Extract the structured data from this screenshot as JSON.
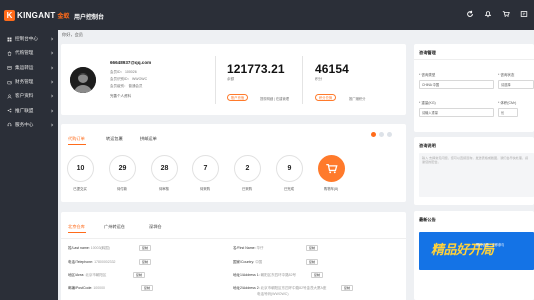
{
  "header": {
    "logo_mark": "K",
    "logo_text": "KINGANT",
    "logo_sub": "金蚁",
    "site_title": "用户控制台",
    "icons": [
      "refresh-icon",
      "bell-icon",
      "cart-icon",
      "coupon-icon"
    ]
  },
  "sidebar": {
    "items": [
      {
        "label": "控制台中心",
        "icon": "dashboard-icon"
      },
      {
        "label": "代购管理",
        "icon": "shopping-icon"
      },
      {
        "label": "集运转运",
        "icon": "package-icon"
      },
      {
        "label": "财务管理",
        "icon": "wallet-icon"
      },
      {
        "label": "客户资料",
        "icon": "user-icon"
      },
      {
        "label": "推广联盟",
        "icon": "share-icon"
      },
      {
        "label": "服务中心",
        "icon": "headset-icon"
      }
    ]
  },
  "breadcrumb": "你好，会员",
  "profile": {
    "email": "66648937@qq.com",
    "line1": "会员ID：  100026",
    "line2": "会员识别ID：  WWOWC",
    "line3": "会员级别：  普通会员",
    "line4": "完善个人资料",
    "balance": "121773.21",
    "balance_label": "余额",
    "recharge_btn": "账户充值",
    "withdraw_link": "提现明细 | 在建管理",
    "points": "46154",
    "points_label": "积分",
    "points_btn": "积分兑换",
    "promo_link": "推广赚积分"
  },
  "orders": {
    "tabs": [
      "代购订单",
      "转运包裹",
      "拼邮运单"
    ],
    "stats": [
      {
        "value": "10",
        "label": "已提交买"
      },
      {
        "value": "29",
        "label": "待付款"
      },
      {
        "value": "28",
        "label": "待审核"
      },
      {
        "value": "7",
        "label": "待采购"
      },
      {
        "value": "2",
        "label": "已采购"
      },
      {
        "value": "9",
        "label": "已完成"
      }
    ],
    "cart_label": "购物车(8)"
  },
  "address": {
    "tabs": [
      "北京仓库",
      "广州转运仓",
      "深圳仓"
    ],
    "rows": [
      {
        "label": "姓/Last name:",
        "value": "10003(韩国)"
      },
      {
        "label": "名/First Name:",
        "value": "华仔"
      },
      {
        "label": "电话/Telephone:",
        "value": "17800002332"
      },
      {
        "label": "国家/Country:",
        "value": "中国"
      },
      {
        "label": "地区/Area:",
        "value": "北京市朝阳区"
      },
      {
        "label": "地址1/Address 1:",
        "value": "朝阳区东四环中路82号"
      },
      {
        "label": "邮编/PostCode:",
        "value": "100000"
      },
      {
        "label": "地址2/Address 2:",
        "value": "北京市朝阳区东四环中路82号金茂大厦A座"
      },
      {
        "label": "",
        "value": "电话号码(WWOWC)"
      }
    ],
    "copy_label": "复制"
  },
  "consult": {
    "title": "咨询管理",
    "type_label": "* 咨询类型",
    "type_value": "CHINA 中国",
    "status_label": "* 咨询状态",
    "status_value": "请选择",
    "amount_label": "* 重量(KG)",
    "amount_placeholder": "请输入重量",
    "size_label": "* 体积(CM³)",
    "size_placeholder": "长"
  },
  "inquiry": {
    "title": "咨询说明",
    "placeholder": "输入 支撑常见问题，您可以直接咨询，发送表格或截图，我们会尽快处理，感谢您的配合。"
  },
  "news": {
    "title": "最新公告",
    "banner_text": "精品好开局",
    "banner_sub": "限时优惠 · 立即参与"
  }
}
